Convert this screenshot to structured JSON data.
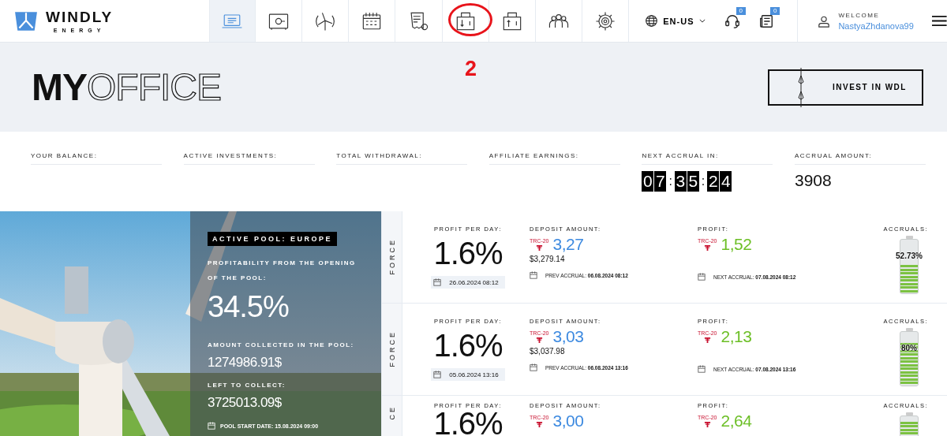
{
  "header": {
    "brand": "WINDLY",
    "brand_sub": "ENERGY",
    "nav": [
      {
        "kind": "laptop",
        "selected": true
      },
      {
        "kind": "safe",
        "selected": false
      },
      {
        "kind": "turbine",
        "selected": false
      },
      {
        "kind": "calendar",
        "selected": false
      },
      {
        "kind": "receipt",
        "selected": false
      },
      {
        "kind": "deposit",
        "selected": false
      },
      {
        "kind": "withdraw",
        "selected": false
      },
      {
        "kind": "team",
        "selected": false
      },
      {
        "kind": "settings",
        "selected": false
      }
    ],
    "language": "EN-US",
    "support_badge": "0",
    "news_badge": "0",
    "welcome": "WELCOME",
    "username": "NastyaZhdanova99"
  },
  "annotation": {
    "label": "2"
  },
  "hero": {
    "title_bold": "MY",
    "title_outline": "OFFICE",
    "invest_button": "INVEST IN WDL"
  },
  "stats": [
    {
      "label": "YOUR BALANCE:"
    },
    {
      "label": "ACTIVE INVESTMENTS:"
    },
    {
      "label": "TOTAL WITHDRAWAL:"
    },
    {
      "label": "AFFILIATE EARNINGS:"
    },
    {
      "label": "NEXT ACCRUAL IN:",
      "kind": "countdown",
      "value": "07:35:24"
    },
    {
      "label": "ACCRUAL AMOUNT:",
      "kind": "amount",
      "value": "3908"
    }
  ],
  "pool": {
    "badge": "ACTIVE POOL: EUROPE",
    "profitability_label": "PROFITABILITY FROM THE OPENING OF THE POOL:",
    "profitability": "34.5%",
    "collected_label": "AMOUNT COLLECTED IN THE POOL:",
    "collected": "1274986.91$",
    "left_label": "LEFT TO COLLECT:",
    "left": "3725013.09$",
    "start_date": "POOL START DATE: 15.08.2024 09:00"
  },
  "deposits": [
    {
      "side_label": "FORCE",
      "profit_per_day_label": "PROFIT PER DAY:",
      "profit_per_day": "1.6%",
      "date": "26.06.2024 08:12",
      "deposit_label": "DEPOSIT AMOUNT:",
      "token": "TRC-20",
      "deposit_amount": "3,27",
      "deposit_usd": "$3,279.14",
      "prev_accrual_label": "PREV ACCRUAL:",
      "prev_accrual": "06.08.2024 08:12",
      "profit_label": "PROFIT:",
      "profit_token": "TRC-20",
      "profit": "1,52",
      "next_accrual_label": "NEXT ACCRUAL:",
      "next_accrual": "07.08.2024 08:12",
      "accruals_label": "ACCRUALS:",
      "level": 0.5273,
      "percent": "52.73%"
    },
    {
      "side_label": "FORCE",
      "profit_per_day_label": "PROFIT PER DAY:",
      "profit_per_day": "1.6%",
      "date": "05.06.2024 13:16",
      "deposit_label": "DEPOSIT AMOUNT:",
      "token": "TRC-20",
      "deposit_amount": "3,03",
      "deposit_usd": "$3,037.98",
      "prev_accrual_label": "PREV ACCRUAL:",
      "prev_accrual": "06.08.2024 13:16",
      "profit_label": "PROFIT:",
      "profit_token": "TRC-20",
      "profit": "2,13",
      "next_accrual_label": "NEXT ACCRUAL:",
      "next_accrual": "07.08.2024 13:16",
      "accruals_label": "ACCRUALS:",
      "level": 0.8,
      "percent": "80%"
    },
    {
      "side_label": "CE",
      "profit_per_day_label": "PROFIT PER DAY:",
      "profit_per_day": "1.6%",
      "deposit_label": "DEPOSIT AMOUNT:",
      "token": "TRC-20",
      "deposit_amount": "3,00",
      "profit_label": "PROFIT:",
      "profit_token": "TRC-20",
      "profit": "2,64",
      "accruals_label": "ACCRUALS:",
      "level": 0.9
    }
  ]
}
